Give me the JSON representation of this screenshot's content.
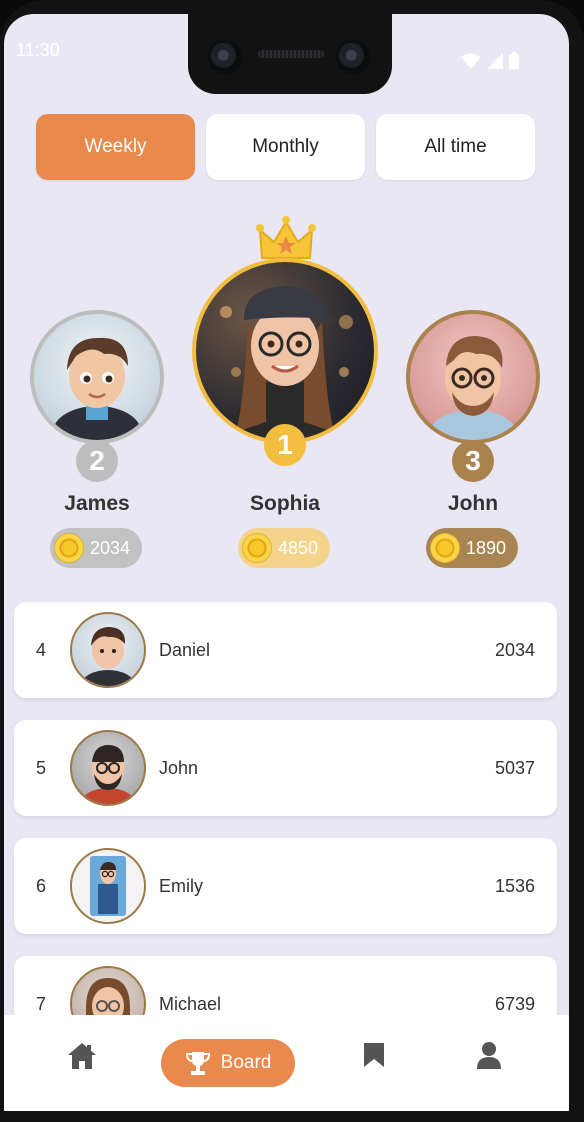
{
  "status": {
    "time": "11:30"
  },
  "tabs": [
    {
      "label": "Weekly",
      "active": true
    },
    {
      "label": "Monthly",
      "active": false
    },
    {
      "label": "All time",
      "active": false
    }
  ],
  "podium": [
    {
      "rank": "2",
      "name": "James",
      "score": "2034",
      "ring_color": "#bdbdbd",
      "pill_color": "#c2c2c2"
    },
    {
      "rank": "1",
      "name": "Sophia",
      "score": "4850",
      "ring_color": "#f3bd3f",
      "pill_color": "#f4d38b"
    },
    {
      "rank": "3",
      "name": "John",
      "score": "1890",
      "ring_color": "#a9824e",
      "pill_color": "#a88553"
    }
  ],
  "leaderboard": [
    {
      "rank": "4",
      "name": "Daniel",
      "score": "2034"
    },
    {
      "rank": "5",
      "name": "John",
      "score": "5037"
    },
    {
      "rank": "6",
      "name": "Emily",
      "score": "1536"
    },
    {
      "rank": "7",
      "name": "Michael",
      "score": "6739"
    }
  ],
  "nav": {
    "home_icon": "home-icon",
    "board_label": "Board",
    "board_icon": "trophy-icon",
    "bookmark_icon": "bookmark-icon",
    "profile_icon": "profile-icon"
  },
  "colors": {
    "accent": "#e8894d",
    "background": "#e9e7f3",
    "gold": "#f3bd3f",
    "silver": "#bdbdbd",
    "bronze": "#a9824e"
  }
}
